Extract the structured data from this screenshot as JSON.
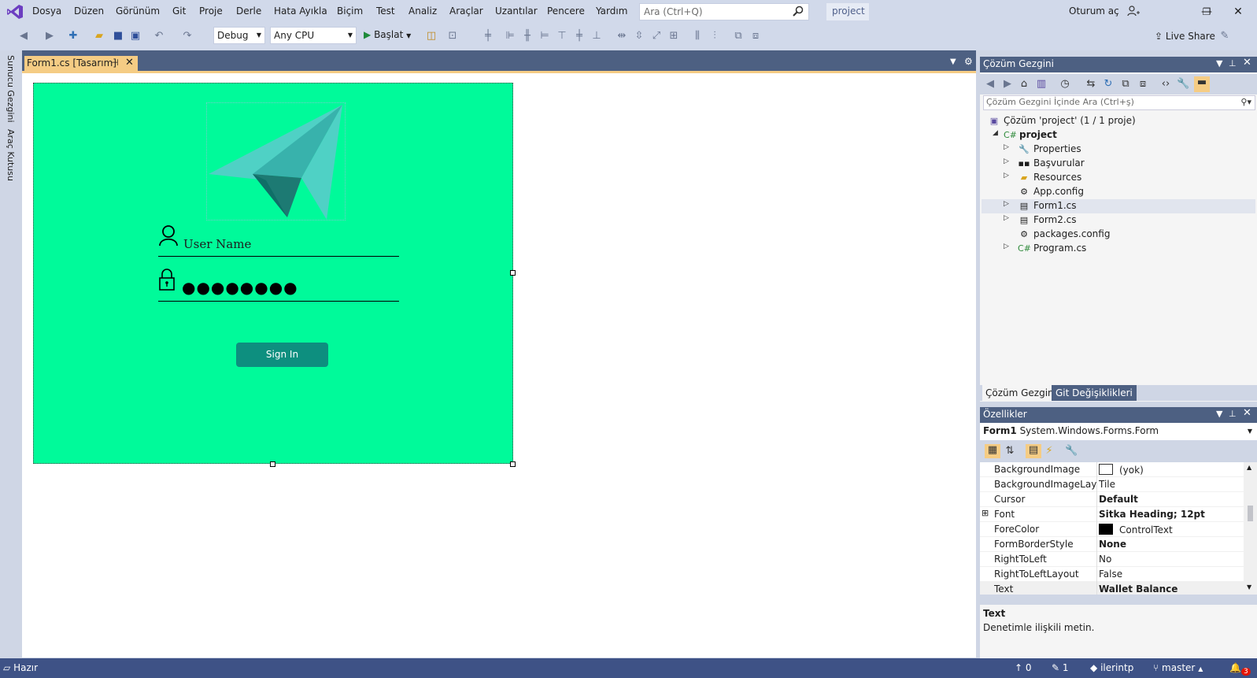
{
  "menu": {
    "items": [
      "Dosya",
      "Düzen",
      "Görünüm",
      "Git",
      "Proje",
      "Derle",
      "Hata Ayıkla",
      "Biçim",
      "Test",
      "Analiz",
      "Araçlar",
      "Uzantılar",
      "Pencere",
      "Yardım"
    ],
    "search_placeholder": "Ara (Ctrl+Q)",
    "project_name": "project",
    "sign_in": "Oturum aç"
  },
  "toolbar": {
    "config": "Debug",
    "platform": "Any CPU",
    "start": "Başlat",
    "live_share": "Live Share"
  },
  "side_tabs": [
    "Sunucu Gezgini",
    "Araç Kutusu"
  ],
  "document_tab": {
    "title": "Form1.cs [Tasarım]"
  },
  "form": {
    "username_label": "User Name",
    "password_dots": "●●●●●●●●",
    "sign_in_button": "Sign In",
    "background": "#00fa9a",
    "button_color": "#0d8f7f"
  },
  "solution_explorer": {
    "title": "Çözüm Gezgini",
    "search_placeholder": "Çözüm Gezgini İçinde Ara (Ctrl+ş)",
    "solution": "Çözüm 'project' (1 / 1 proje)",
    "project": "project",
    "items": [
      "Properties",
      "Başvurular",
      "Resources",
      "App.config",
      "Form1.cs",
      "Form2.cs",
      "packages.config",
      "Program.cs"
    ],
    "tabs": [
      "Çözüm Gezgini",
      "Git Değişiklikleri"
    ]
  },
  "properties": {
    "title": "Özellikler",
    "object_name": "Form1",
    "object_type": "System.Windows.Forms.Form",
    "rows": [
      {
        "name": "BackgroundImage",
        "value": "(yok)"
      },
      {
        "name": "BackgroundImageLayou",
        "value": "Tile"
      },
      {
        "name": "Cursor",
        "value": "Default"
      },
      {
        "name": "Font",
        "value": "Sitka Heading; 12pt"
      },
      {
        "name": "ForeColor",
        "value": "ControlText"
      },
      {
        "name": "FormBorderStyle",
        "value": "None"
      },
      {
        "name": "RightToLeft",
        "value": "No"
      },
      {
        "name": "RightToLeftLayout",
        "value": "False"
      },
      {
        "name": "Text",
        "value": "Wallet Balance"
      }
    ],
    "desc_title": "Text",
    "desc_text": "Denetimle ilişkili metin."
  },
  "status": {
    "ready": "Hazır",
    "up": "0",
    "pencil": "1",
    "repo": "ilerintp",
    "branch": "master",
    "notifications": "3"
  }
}
